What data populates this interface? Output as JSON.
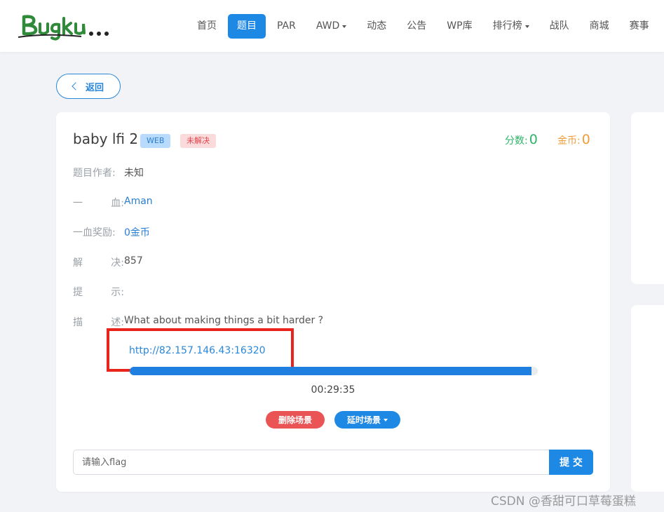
{
  "site": {
    "logo_text": "Bugku..."
  },
  "nav": {
    "items": [
      {
        "label": "首页"
      },
      {
        "label": "题目"
      },
      {
        "label": "PAR"
      },
      {
        "label": "AWD"
      },
      {
        "label": "动态"
      },
      {
        "label": "公告"
      },
      {
        "label": "WP库"
      },
      {
        "label": "排行榜"
      },
      {
        "label": "战队"
      },
      {
        "label": "商城"
      },
      {
        "label": "赛事"
      }
    ],
    "active": "题目"
  },
  "back_button": {
    "label": "返回"
  },
  "challenge": {
    "title": "baby lfi 2",
    "category_badge": "WEB",
    "status_badge": "未解决",
    "points_label": "分数:",
    "points_value": "0",
    "coins_label": "金币:",
    "coins_value": "0",
    "author_label": "题目作者:",
    "author_value": "未知",
    "first_blood_label": [
      "一",
      "血:"
    ],
    "first_blood_value": "Aman",
    "first_blood_reward_label": "一血奖励:",
    "first_blood_reward_value": "0金币",
    "solves_label": [
      "解",
      "决:"
    ],
    "solves_value": "857",
    "hint_label": [
      "提",
      "示:"
    ],
    "hint_value": "",
    "desc_label": [
      "描",
      "述:"
    ],
    "desc_value": "What about making things a bit harder ?",
    "env_url": "http://82.157.146.43:16320",
    "remaining_progress_fraction": 0.985,
    "timer": "00:29:35",
    "delete_button": "删除场景",
    "extend_button": "延时场景",
    "flag_placeholder": "请输入flag",
    "submit_button": "提 交"
  },
  "colors": {
    "primary": "#1e88e5",
    "danger": "#ea5455",
    "points": "#2fb369",
    "coins": "#f39c3a",
    "highlight_box": "#e8241c"
  },
  "watermark": "CSDN @香甜可口草莓蛋糕"
}
